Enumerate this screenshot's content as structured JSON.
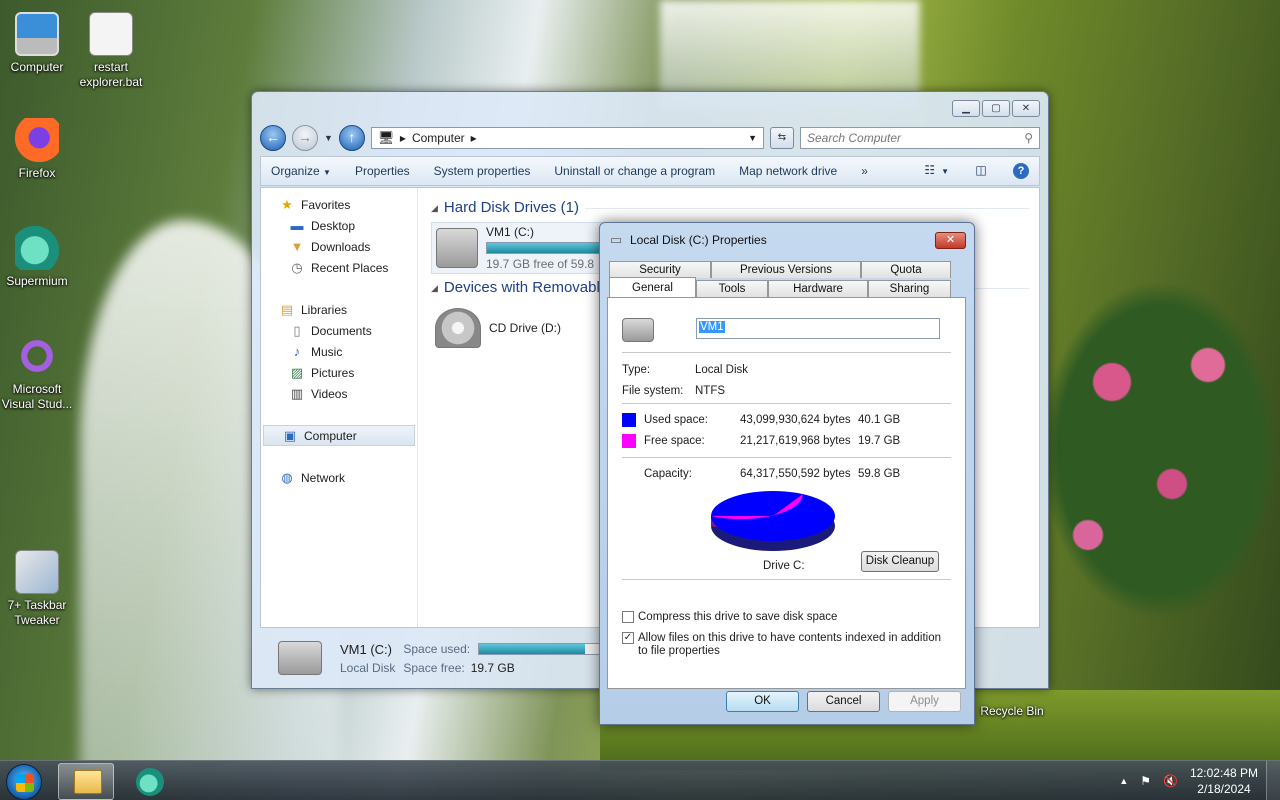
{
  "desktop": {
    "icons": [
      {
        "label": "Computer",
        "icon": "computer-icon"
      },
      {
        "label": "restart explorer.bat",
        "icon": "batch-file-icon"
      },
      {
        "label": "Firefox",
        "icon": "firefox-icon"
      },
      {
        "label": "Supermium",
        "icon": "supermium-icon"
      },
      {
        "label": "Microsoft Visual Stud...",
        "icon": "visual-studio-icon"
      },
      {
        "label": "7+ Taskbar Tweaker",
        "icon": "taskbar-tweaker-icon"
      },
      {
        "label": "Recycle Bin",
        "icon": "recycle-bin-icon"
      }
    ]
  },
  "explorer": {
    "address": {
      "root": "Computer"
    },
    "search_placeholder": "Search Computer",
    "toolbar": {
      "organize": "Organize",
      "properties": "Properties",
      "system_properties": "System properties",
      "uninstall": "Uninstall or change a program",
      "map_drive": "Map network drive",
      "more": "»"
    },
    "nav": {
      "favorites": "Favorites",
      "desktop": "Desktop",
      "downloads": "Downloads",
      "recent": "Recent Places",
      "libraries": "Libraries",
      "documents": "Documents",
      "music": "Music",
      "pictures": "Pictures",
      "videos": "Videos",
      "computer": "Computer",
      "network": "Network"
    },
    "groups": {
      "hdd": "Hard Disk Drives (1)",
      "removable": "Devices with Removable"
    },
    "drives": {
      "c": {
        "name": "VM1 (C:)",
        "free_text": "19.7 GB free of 59.8",
        "used_fraction": 0.67
      },
      "d": {
        "name": "CD Drive (D:)"
      }
    },
    "details": {
      "name": "VM1 (C:)",
      "type": "Local Disk",
      "space_used_label": "Space used:",
      "space_free_label": "Space free:",
      "space_free_value": "19.7 GB",
      "used_fraction": 0.67
    }
  },
  "dialog": {
    "title": "Local Disk (C:) Properties",
    "tabs_top": [
      "Security",
      "Previous Versions",
      "Quota"
    ],
    "tabs_bottom": [
      "General",
      "Tools",
      "Hardware",
      "Sharing"
    ],
    "active_tab": "General",
    "name_value": "VM1",
    "type_label": "Type:",
    "type_value": "Local Disk",
    "fs_label": "File system:",
    "fs_value": "NTFS",
    "used": {
      "label": "Used space:",
      "bytes": "43,099,930,624 bytes",
      "size": "40.1 GB",
      "color": "#0000ff"
    },
    "free": {
      "label": "Free space:",
      "bytes": "21,217,619,968 bytes",
      "size": "19.7 GB",
      "color": "#ff00ff"
    },
    "capacity": {
      "label": "Capacity:",
      "bytes": "64,317,550,592 bytes",
      "size": "59.8 GB"
    },
    "drive_label": "Drive C:",
    "disk_cleanup": "Disk Cleanup",
    "compress_label": "Compress this drive to save disk space",
    "compress_checked": false,
    "index_label": "Allow files on this drive to have contents indexed in addition to file properties",
    "index_checked": true,
    "ok": "OK",
    "cancel": "Cancel",
    "apply": "Apply"
  },
  "taskbar": {
    "time": "12:02:48 PM",
    "date": "2/18/2024"
  }
}
